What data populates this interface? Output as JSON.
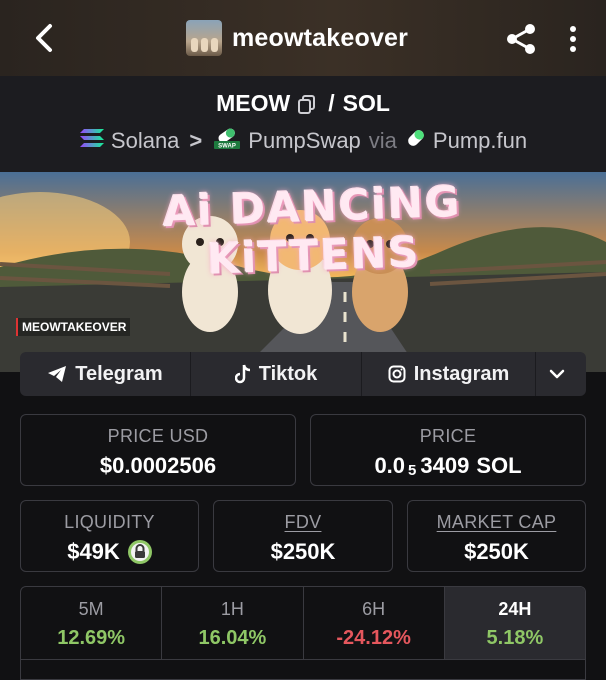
{
  "header": {
    "title": "meowtakeover",
    "avatar": "token-avatar"
  },
  "pair": {
    "base": "MEOW",
    "separator": "/",
    "quote": "SOL"
  },
  "chain": {
    "network": "Solana",
    "dex": "PumpSwap",
    "via": "via",
    "launchpad": "Pump.fun",
    "swap_badge": "SWAP"
  },
  "banner": {
    "title": "Ai DANCiNG KiTTENS",
    "watermark": "MEOWTAKEOVER"
  },
  "socials": [
    {
      "label": "Telegram",
      "icon": "telegram-icon"
    },
    {
      "label": "Tiktok",
      "icon": "tiktok-icon"
    },
    {
      "label": "Instagram",
      "icon": "instagram-icon"
    }
  ],
  "stats": {
    "price_usd": {
      "label": "PRICE USD",
      "value": "$0.0002506"
    },
    "price_native": {
      "label": "PRICE",
      "prefix": "0.0",
      "subscript": "5",
      "digits": "3409",
      "unit": "SOL"
    },
    "liquidity": {
      "label": "LIQUIDITY",
      "value": "$49K"
    },
    "fdv": {
      "label": "FDV",
      "value": "$250K"
    },
    "market_cap": {
      "label": "MARKET CAP",
      "value": "$250K"
    }
  },
  "timeframes": [
    {
      "label": "5M",
      "change": "12.69%",
      "color": "#8fc766"
    },
    {
      "label": "1H",
      "change": "16.04%",
      "color": "#8fc766"
    },
    {
      "label": "6H",
      "change": "-24.12%",
      "color": "#e5575d"
    },
    {
      "label": "24H",
      "change": "5.18%",
      "color": "#8fc766"
    }
  ],
  "colors": {
    "positive": "#8fc766",
    "negative": "#e5575d",
    "background": "#111113",
    "panel": "#2a2a2f"
  }
}
